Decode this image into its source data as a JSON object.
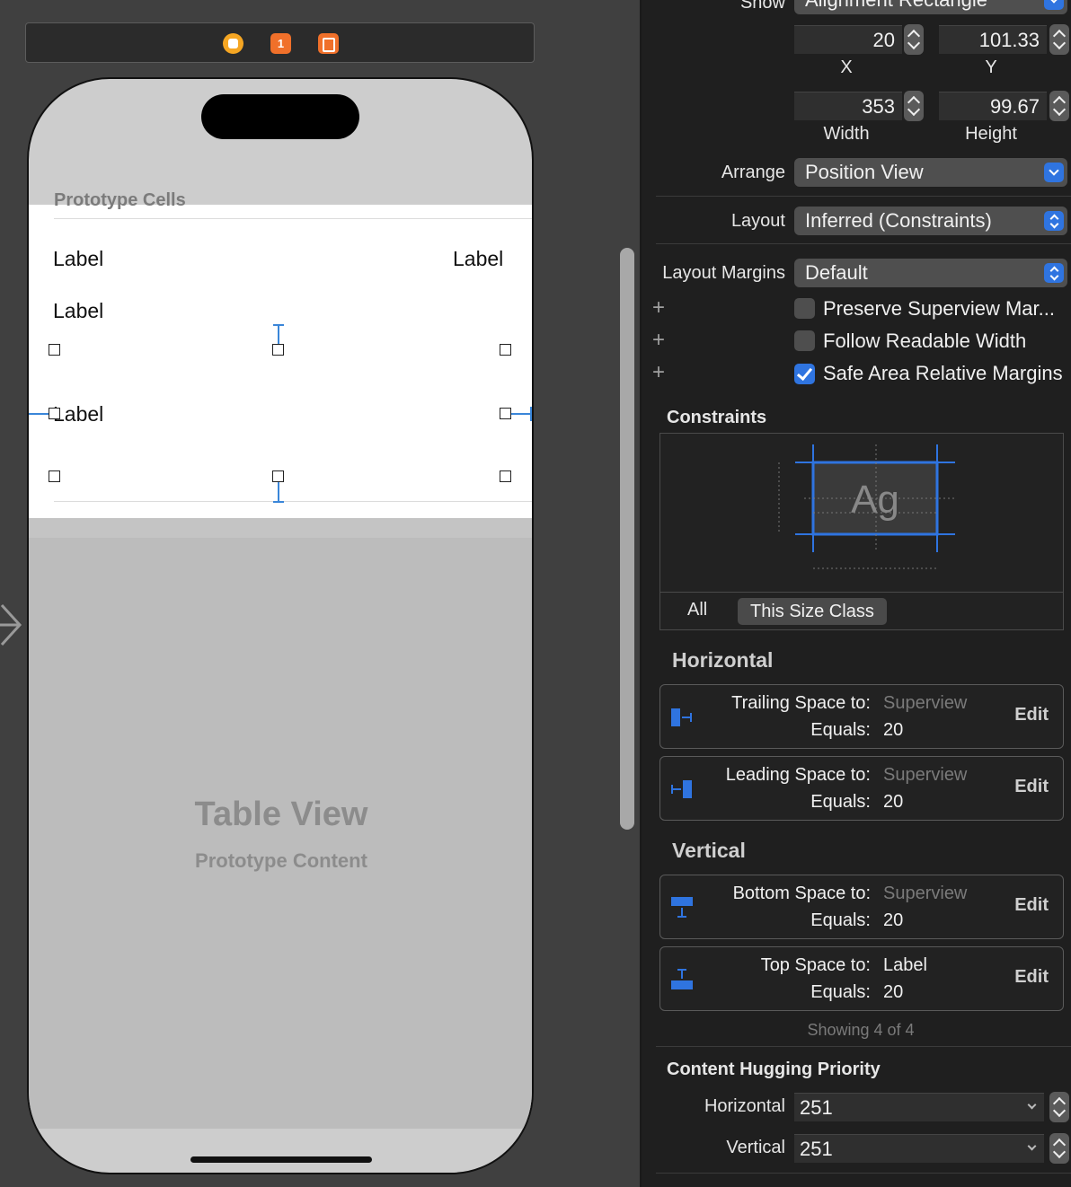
{
  "canvas": {
    "scene_badge_first": "1",
    "prototype_header": "Prototype Cells",
    "labels": [
      "Label",
      "Label",
      "Label",
      "Label"
    ],
    "table_view_title": "Table View",
    "table_view_subtitle": "Prototype Content"
  },
  "inspector": {
    "show_label": "Show",
    "show_value": "Alignment Rectangle",
    "x_value": "20",
    "x_caption": "X",
    "y_value": "101.33",
    "y_caption": "Y",
    "width_value": "353",
    "width_caption": "Width",
    "height_value": "99.67",
    "height_caption": "Height",
    "arrange_label": "Arrange",
    "arrange_value": "Position View",
    "layout_label": "Layout",
    "layout_value": "Inferred (Constraints)",
    "layout_margins_label": "Layout Margins",
    "layout_margins_value": "Default",
    "checks": [
      {
        "label": "Preserve Superview Mar...",
        "checked": false
      },
      {
        "label": "Follow Readable Width",
        "checked": false
      },
      {
        "label": "Safe Area Relative Margins",
        "checked": true
      }
    ],
    "constraints_title": "Constraints",
    "preview_text": "Ag",
    "tab_all": "All",
    "tab_this_size_class": "This Size Class",
    "horizontal_title": "Horizontal",
    "vertical_title": "Vertical",
    "equals_label": "Equals:",
    "edit_label": "Edit",
    "constraints": [
      {
        "key": "Trailing Space to:",
        "target": "Superview",
        "value": "20",
        "icon": "trailing-space-icon"
      },
      {
        "key": "Leading Space to:",
        "target": "Superview",
        "value": "20",
        "icon": "leading-space-icon"
      },
      {
        "key": "Bottom Space to:",
        "target": "Superview",
        "value": "20",
        "icon": "bottom-space-icon"
      },
      {
        "key": "Top Space to:",
        "target": "Label",
        "value": "20",
        "icon": "top-space-icon"
      }
    ],
    "showing_count": "Showing 4 of 4",
    "hugging_title": "Content Hugging Priority",
    "hugging_horizontal_label": "Horizontal",
    "hugging_horizontal_value": "251",
    "hugging_vertical_label": "Vertical",
    "hugging_vertical_value": "251",
    "accent_color": "#2f74e0"
  }
}
